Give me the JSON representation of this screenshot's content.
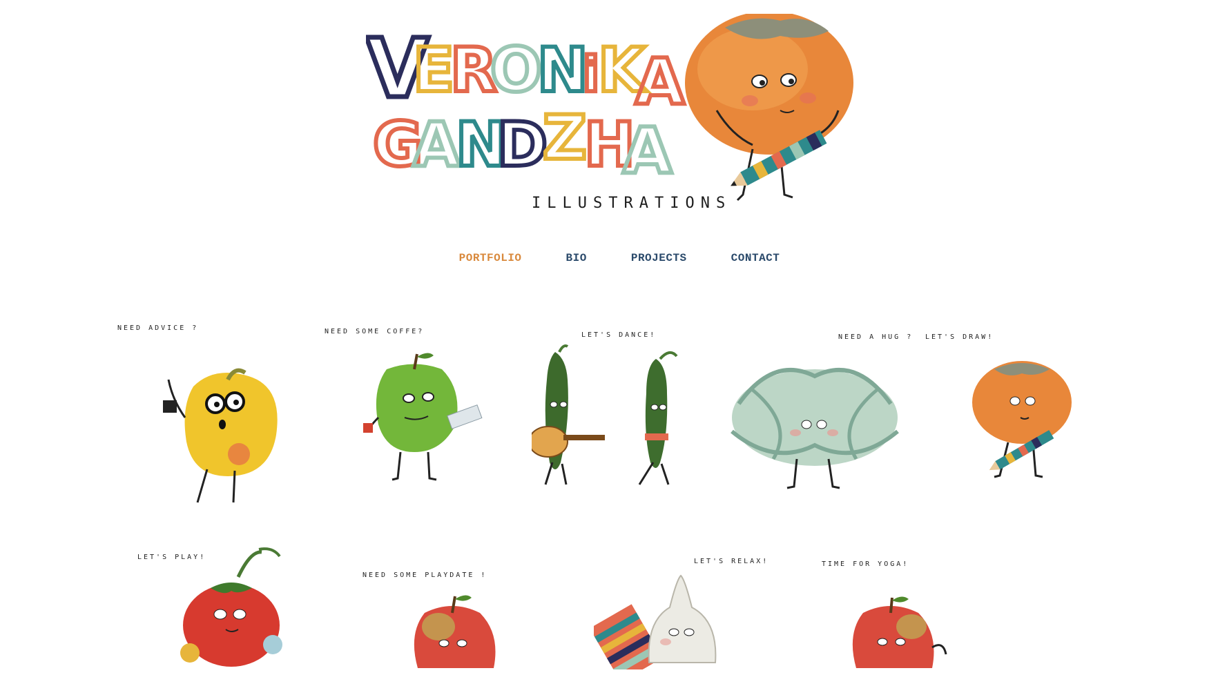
{
  "header": {
    "logo_line1": "VERONIKA",
    "logo_line2": "GANDZHA",
    "tagline": "ILLUSTRATIONS"
  },
  "nav": {
    "items": [
      {
        "label": "PORTFOLIO",
        "active": true
      },
      {
        "label": "BIO",
        "active": false
      },
      {
        "label": "PROJECTS",
        "active": false
      },
      {
        "label": "CONTACT",
        "active": false
      }
    ]
  },
  "gallery": {
    "items": [
      {
        "caption": "NEED ADVICE ?",
        "character": "yellow-pepper-icon"
      },
      {
        "caption": "NEED SOME COFFE?",
        "character": "green-apple-icon"
      },
      {
        "caption": "LET'S DANCE!",
        "character": "jalapeno-pair-icon"
      },
      {
        "caption": "NEED A HUG ?",
        "character": "air-plant-icon"
      },
      {
        "caption": "LET'S DRAW!",
        "character": "persimmon-icon"
      },
      {
        "caption": "LET'S PLAY!",
        "character": "tomato-icon"
      },
      {
        "caption": "NEED SOME PLAYDATE !",
        "character": "red-apple-icon"
      },
      {
        "caption": "LET'S RELAX!",
        "character": "garlic-icon"
      },
      {
        "caption": "TIME FOR YOGA!",
        "character": "yoga-apple-icon"
      }
    ]
  },
  "colors": {
    "nav_default": "#2b4a6b",
    "nav_active": "#d9893c",
    "logo_palette": [
      "#2b2d5c",
      "#e7b53b",
      "#e3694e",
      "#9cc7b4",
      "#2e8a8c"
    ]
  }
}
